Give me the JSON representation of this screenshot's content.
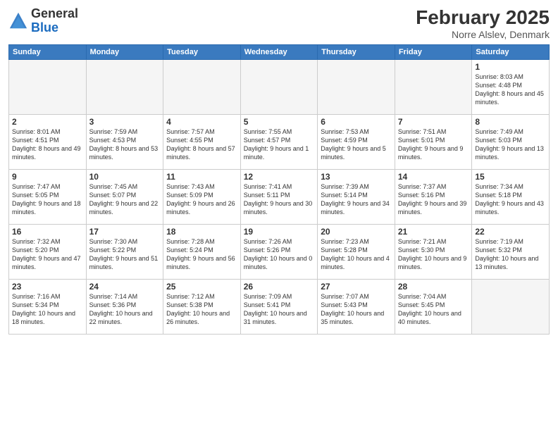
{
  "header": {
    "logo_general": "General",
    "logo_blue": "Blue",
    "month_title": "February 2025",
    "location": "Norre Alslev, Denmark"
  },
  "weekdays": [
    "Sunday",
    "Monday",
    "Tuesday",
    "Wednesday",
    "Thursday",
    "Friday",
    "Saturday"
  ],
  "weeks": [
    [
      {
        "day": "",
        "info": ""
      },
      {
        "day": "",
        "info": ""
      },
      {
        "day": "",
        "info": ""
      },
      {
        "day": "",
        "info": ""
      },
      {
        "day": "",
        "info": ""
      },
      {
        "day": "",
        "info": ""
      },
      {
        "day": "1",
        "info": "Sunrise: 8:03 AM\nSunset: 4:48 PM\nDaylight: 8 hours and 45 minutes."
      }
    ],
    [
      {
        "day": "2",
        "info": "Sunrise: 8:01 AM\nSunset: 4:51 PM\nDaylight: 8 hours and 49 minutes."
      },
      {
        "day": "3",
        "info": "Sunrise: 7:59 AM\nSunset: 4:53 PM\nDaylight: 8 hours and 53 minutes."
      },
      {
        "day": "4",
        "info": "Sunrise: 7:57 AM\nSunset: 4:55 PM\nDaylight: 8 hours and 57 minutes."
      },
      {
        "day": "5",
        "info": "Sunrise: 7:55 AM\nSunset: 4:57 PM\nDaylight: 9 hours and 1 minute."
      },
      {
        "day": "6",
        "info": "Sunrise: 7:53 AM\nSunset: 4:59 PM\nDaylight: 9 hours and 5 minutes."
      },
      {
        "day": "7",
        "info": "Sunrise: 7:51 AM\nSunset: 5:01 PM\nDaylight: 9 hours and 9 minutes."
      },
      {
        "day": "8",
        "info": "Sunrise: 7:49 AM\nSunset: 5:03 PM\nDaylight: 9 hours and 13 minutes."
      }
    ],
    [
      {
        "day": "9",
        "info": "Sunrise: 7:47 AM\nSunset: 5:05 PM\nDaylight: 9 hours and 18 minutes."
      },
      {
        "day": "10",
        "info": "Sunrise: 7:45 AM\nSunset: 5:07 PM\nDaylight: 9 hours and 22 minutes."
      },
      {
        "day": "11",
        "info": "Sunrise: 7:43 AM\nSunset: 5:09 PM\nDaylight: 9 hours and 26 minutes."
      },
      {
        "day": "12",
        "info": "Sunrise: 7:41 AM\nSunset: 5:11 PM\nDaylight: 9 hours and 30 minutes."
      },
      {
        "day": "13",
        "info": "Sunrise: 7:39 AM\nSunset: 5:14 PM\nDaylight: 9 hours and 34 minutes."
      },
      {
        "day": "14",
        "info": "Sunrise: 7:37 AM\nSunset: 5:16 PM\nDaylight: 9 hours and 39 minutes."
      },
      {
        "day": "15",
        "info": "Sunrise: 7:34 AM\nSunset: 5:18 PM\nDaylight: 9 hours and 43 minutes."
      }
    ],
    [
      {
        "day": "16",
        "info": "Sunrise: 7:32 AM\nSunset: 5:20 PM\nDaylight: 9 hours and 47 minutes."
      },
      {
        "day": "17",
        "info": "Sunrise: 7:30 AM\nSunset: 5:22 PM\nDaylight: 9 hours and 51 minutes."
      },
      {
        "day": "18",
        "info": "Sunrise: 7:28 AM\nSunset: 5:24 PM\nDaylight: 9 hours and 56 minutes."
      },
      {
        "day": "19",
        "info": "Sunrise: 7:26 AM\nSunset: 5:26 PM\nDaylight: 10 hours and 0 minutes."
      },
      {
        "day": "20",
        "info": "Sunrise: 7:23 AM\nSunset: 5:28 PM\nDaylight: 10 hours and 4 minutes."
      },
      {
        "day": "21",
        "info": "Sunrise: 7:21 AM\nSunset: 5:30 PM\nDaylight: 10 hours and 9 minutes."
      },
      {
        "day": "22",
        "info": "Sunrise: 7:19 AM\nSunset: 5:32 PM\nDaylight: 10 hours and 13 minutes."
      }
    ],
    [
      {
        "day": "23",
        "info": "Sunrise: 7:16 AM\nSunset: 5:34 PM\nDaylight: 10 hours and 18 minutes."
      },
      {
        "day": "24",
        "info": "Sunrise: 7:14 AM\nSunset: 5:36 PM\nDaylight: 10 hours and 22 minutes."
      },
      {
        "day": "25",
        "info": "Sunrise: 7:12 AM\nSunset: 5:38 PM\nDaylight: 10 hours and 26 minutes."
      },
      {
        "day": "26",
        "info": "Sunrise: 7:09 AM\nSunset: 5:41 PM\nDaylight: 10 hours and 31 minutes."
      },
      {
        "day": "27",
        "info": "Sunrise: 7:07 AM\nSunset: 5:43 PM\nDaylight: 10 hours and 35 minutes."
      },
      {
        "day": "28",
        "info": "Sunrise: 7:04 AM\nSunset: 5:45 PM\nDaylight: 10 hours and 40 minutes."
      },
      {
        "day": "",
        "info": ""
      }
    ]
  ]
}
